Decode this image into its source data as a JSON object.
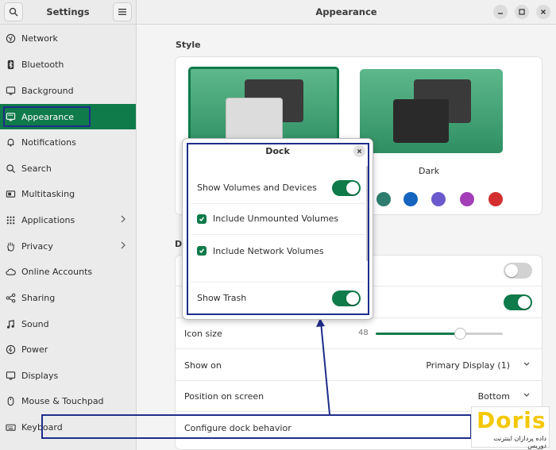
{
  "sidebar": {
    "title": "Settings",
    "items": [
      {
        "label": "Network",
        "icon": "globe-icon"
      },
      {
        "label": "Bluetooth",
        "icon": "bluetooth-icon"
      },
      {
        "label": "Background",
        "icon": "monitor-icon"
      },
      {
        "label": "Appearance",
        "icon": "appearance-icon"
      },
      {
        "label": "Notifications",
        "icon": "bell-icon"
      },
      {
        "label": "Search",
        "icon": "search-icon"
      },
      {
        "label": "Multitasking",
        "icon": "multitasking-icon"
      },
      {
        "label": "Applications",
        "icon": "grid-icon"
      },
      {
        "label": "Privacy",
        "icon": "hand-icon"
      },
      {
        "label": "Online Accounts",
        "icon": "cloud-icon"
      },
      {
        "label": "Sharing",
        "icon": "share-icon"
      },
      {
        "label": "Sound",
        "icon": "music-icon"
      },
      {
        "label": "Power",
        "icon": "power-icon"
      },
      {
        "label": "Displays",
        "icon": "display-icon"
      },
      {
        "label": "Mouse & Touchpad",
        "icon": "mouse-icon"
      },
      {
        "label": "Keyboard",
        "icon": "keyboard-icon"
      }
    ]
  },
  "header": {
    "title": "Appearance"
  },
  "style": {
    "label": "Style",
    "dark_label": "Dark"
  },
  "accent_colors": [
    "#2e7d6e",
    "#1565c0",
    "#6a5acd",
    "#a23fb8",
    "#d32f2f"
  ],
  "dock_section": {
    "label": "D",
    "rows": {
      "icon_size_label": "Icon size",
      "icon_size_value": "48",
      "icon_size_fraction": 0.66,
      "show_on_label": "Show on",
      "show_on_value": "Primary Display (1)",
      "position_label": "Position on screen",
      "position_value": "Bottom",
      "configure_label": "Configure dock behavior"
    },
    "toggles": {
      "row1_on": false,
      "row2_on": true
    }
  },
  "dialog": {
    "title": "Dock",
    "show_volumes": "Show Volumes and Devices",
    "unmounted": "Include Unmounted Volumes",
    "network": "Include Network Volumes",
    "show_trash": "Show Trash"
  },
  "logo": {
    "word": "Doris",
    "sub": "داده پردازان اینترنت دوریس"
  },
  "colors": {
    "accent": "#0f7a4a",
    "highlight": "#1e2d8a"
  }
}
